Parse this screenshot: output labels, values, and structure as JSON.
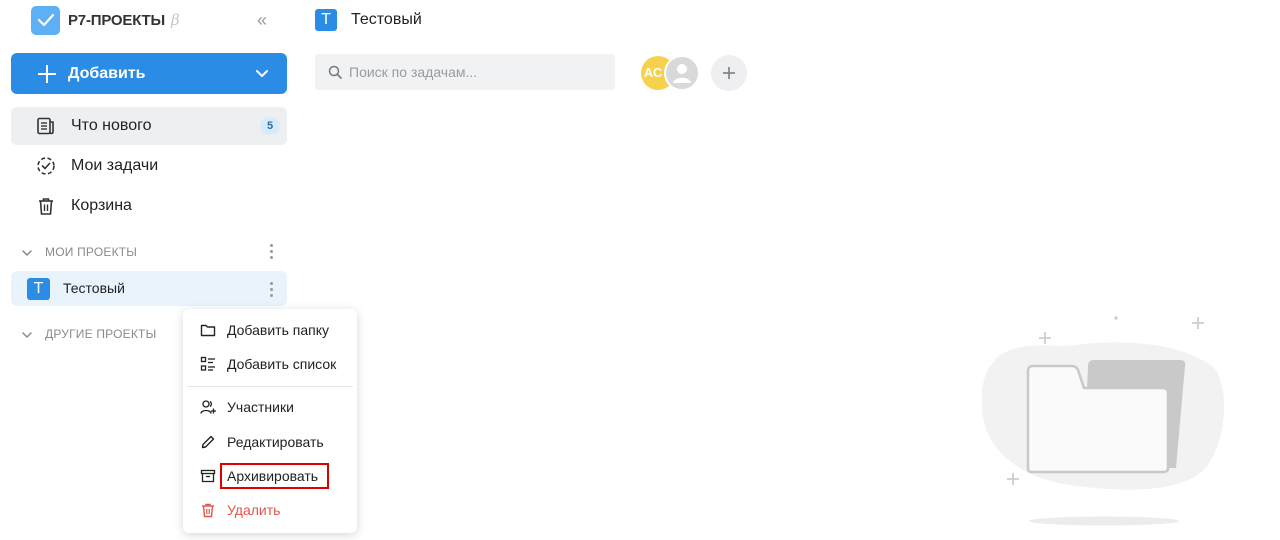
{
  "brand": {
    "name": "Р7-ПРОЕКТЫ",
    "beta": "β"
  },
  "sidebar": {
    "collapse_glyph": "«",
    "add_button": {
      "label": "Добавить"
    },
    "nav": [
      {
        "label": "Что нового",
        "icon": "news-icon",
        "badge": "5"
      },
      {
        "label": "Мои задачи",
        "icon": "tasks-check-icon"
      },
      {
        "label": "Корзина",
        "icon": "trash-icon"
      }
    ],
    "sections": {
      "my_projects": "МОИ ПРОЕКТЫ",
      "other_projects": "ДРУГИЕ ПРОЕКТЫ"
    },
    "project": {
      "letter": "Т",
      "name": "Тестовый"
    }
  },
  "context_menu": {
    "items": [
      {
        "label": "Добавить папку",
        "icon": "folder-icon"
      },
      {
        "label": "Добавить список",
        "icon": "list-icon"
      },
      {
        "label": "Участники",
        "icon": "users-add-icon"
      },
      {
        "label": "Редактировать",
        "icon": "pencil-icon"
      },
      {
        "label": "Архивировать",
        "icon": "archive-icon"
      },
      {
        "label": "Удалить",
        "icon": "trash-icon"
      }
    ]
  },
  "main": {
    "header": {
      "letter": "Т",
      "title": "Тестовый"
    },
    "search": {
      "placeholder": "Поиск по задачам..."
    },
    "members": {
      "avatar_initials": "АС"
    }
  },
  "colors": {
    "accent": "#2b8ce6",
    "highlight": "#e00000",
    "danger": "#e5534b"
  }
}
